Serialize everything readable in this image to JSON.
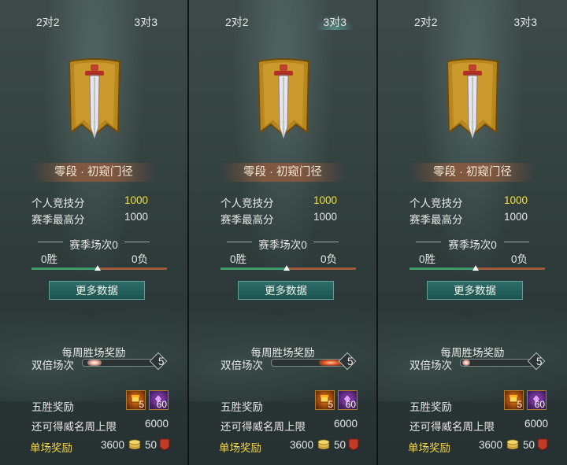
{
  "colors": {
    "highlight_yellow": "#f3e33a",
    "single_reward_label": "#f1d74a",
    "button_teal": "#1e5450"
  },
  "panels": [
    {
      "tabs": [
        {
          "label": "2对2"
        },
        {
          "label": "3对3"
        }
      ],
      "rank_title": "零段 · 初窥门径",
      "stats": [
        {
          "label": "个人竞技分",
          "value": "1000"
        },
        {
          "label": "赛季最高分",
          "value": "1000"
        }
      ],
      "season_matches": "赛季场次0",
      "wins": "0胜",
      "losses": "0负",
      "more_button": "更多数据",
      "weekly_title": "每周胜场奖励",
      "double_label": "双倍场次",
      "double_count": "5",
      "five_win_label": "五胜奖励",
      "reward_items": [
        {
          "icon": "gold-coin-chest-icon",
          "count": "5"
        },
        {
          "icon": "purple-gem-icon",
          "count": "60"
        }
      ],
      "weekly_cap_label": "还可得威名周上限",
      "weekly_cap_value": "6000",
      "single_label": "单场奖励",
      "single_val_1": "3600",
      "single_val_2": "50"
    },
    {
      "tabs": [
        {
          "label": "2对2"
        },
        {
          "label": "3对3"
        }
      ],
      "rank_title": "零段 · 初窥门径",
      "stats": [
        {
          "label": "个人竞技分",
          "value": "1000"
        },
        {
          "label": "赛季最高分",
          "value": "1000"
        }
      ],
      "season_matches": "赛季场次0",
      "wins": "0胜",
      "losses": "0负",
      "more_button": "更多数据",
      "weekly_title": "每周胜场奖励",
      "double_label": "双倍场次",
      "double_count": "5",
      "five_win_label": "五胜奖励",
      "reward_items": [
        {
          "icon": "gold-coin-chest-icon",
          "count": "5"
        },
        {
          "icon": "purple-gem-icon",
          "count": "60"
        }
      ],
      "weekly_cap_label": "还可得威名周上限",
      "weekly_cap_value": "6000",
      "single_label": "单场奖励",
      "single_val_1": "3600",
      "single_val_2": "50"
    },
    {
      "tabs": [
        {
          "label": "2对2"
        },
        {
          "label": "3对3"
        }
      ],
      "rank_title": "零段 · 初窥门径",
      "stats": [
        {
          "label": "个人竞技分",
          "value": "1000"
        },
        {
          "label": "赛季最高分",
          "value": "1000"
        }
      ],
      "season_matches": "赛季场次0",
      "wins": "0胜",
      "losses": "0负",
      "more_button": "更多数据",
      "weekly_title": "每周胜场奖励",
      "double_label": "双倍场次",
      "double_count": "5",
      "five_win_label": "五胜奖励",
      "reward_items": [
        {
          "icon": "gold-coin-chest-icon",
          "count": "5"
        },
        {
          "icon": "purple-gem-icon",
          "count": "60"
        }
      ],
      "weekly_cap_label": "还可得威名周上限",
      "weekly_cap_value": "6000",
      "single_label": "单场奖励",
      "single_val_1": "3600",
      "single_val_2": "50"
    }
  ]
}
